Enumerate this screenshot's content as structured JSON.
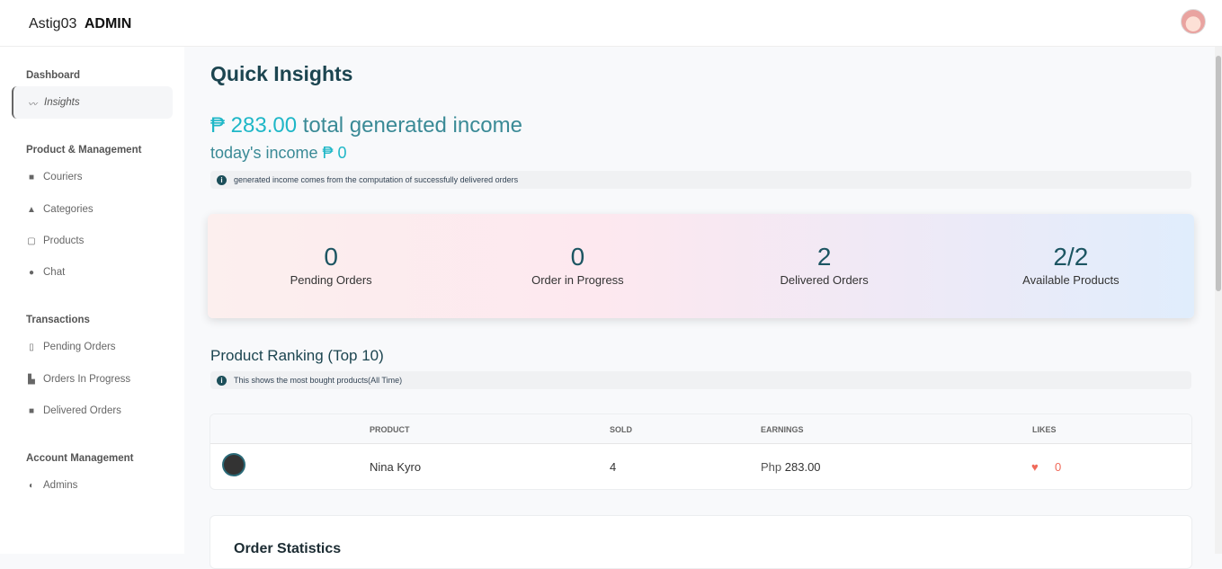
{
  "header": {
    "brand": "Astig03",
    "brand_bold": "ADMIN"
  },
  "sidebar": {
    "sections": [
      {
        "title": "Dashboard",
        "items": [
          {
            "label": "Insights",
            "icon": "pulse-icon",
            "active": true
          }
        ]
      },
      {
        "title": "Product & Management",
        "items": [
          {
            "label": "Couriers",
            "icon": "truck-icon"
          },
          {
            "label": "Categories",
            "icon": "shapes-icon"
          },
          {
            "label": "Products",
            "icon": "bag-icon"
          },
          {
            "label": "Chat",
            "icon": "chat-icon"
          }
        ]
      },
      {
        "title": "Transactions",
        "items": [
          {
            "label": "Pending Orders",
            "icon": "clipboard-clock-icon"
          },
          {
            "label": "Orders In Progress",
            "icon": "dolly-icon"
          },
          {
            "label": "Delivered Orders",
            "icon": "truck-icon"
          }
        ]
      },
      {
        "title": "Account Management",
        "items": [
          {
            "label": "Admins",
            "icon": "shield-icon"
          }
        ]
      }
    ]
  },
  "main": {
    "title": "Quick Insights",
    "total_income": "₱ 283.00",
    "total_income_label": "total generated income",
    "today_label": "today's income",
    "today_income": "₱ 0",
    "income_note": "generated income comes from the computation of successfully delivered orders",
    "stats": [
      {
        "value": "0",
        "label": "Pending Orders"
      },
      {
        "value": "0",
        "label": "Order in Progress"
      },
      {
        "value": "2",
        "label": "Delivered Orders"
      },
      {
        "value": "2/2",
        "label": "Available Products"
      }
    ],
    "ranking_title": "Product Ranking (Top 10)",
    "ranking_note": "This shows the most bought products(All Time)",
    "columns": [
      "PRODUCT",
      "SOLD",
      "EARNINGS",
      "LIKES"
    ],
    "rows": [
      {
        "product": "Nina Kyro",
        "sold": "4",
        "currency": "Php",
        "earnings": "283.00",
        "likes": "0"
      }
    ],
    "order_stats_title": "Order Statistics"
  },
  "colors": {
    "accent": "#1fb7c7",
    "heading": "#1c4550",
    "like": "#f06a5a"
  }
}
